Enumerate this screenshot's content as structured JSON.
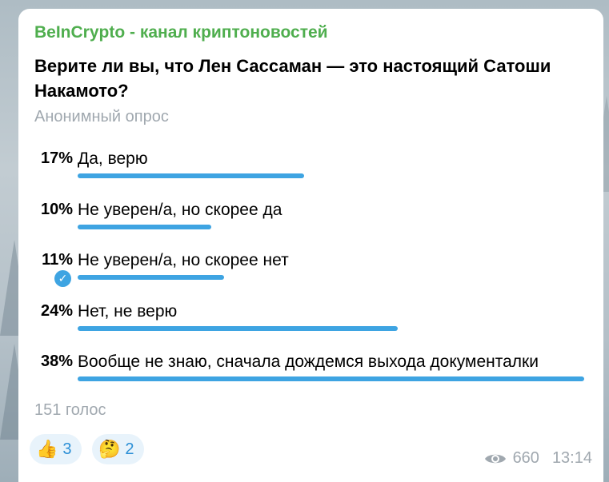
{
  "channel": {
    "name": "BeInCrypto - канал криптоновостей"
  },
  "poll": {
    "question": "Верите ли вы, что Лен Сассаман — это настоящий Сатоши Накамото?",
    "type_label": "Анонимный опрос",
    "options": [
      {
        "percent_label": "17%",
        "percent": 17,
        "text": "Да, верю",
        "selected": false
      },
      {
        "percent_label": "10%",
        "percent": 10,
        "text": "Не уверен/а, но скорее да",
        "selected": false
      },
      {
        "percent_label": "11%",
        "percent": 11,
        "text": "Не уверен/а, но скорее нет",
        "selected": true
      },
      {
        "percent_label": "24%",
        "percent": 24,
        "text": "Нет, не верю",
        "selected": false
      },
      {
        "percent_label": "38%",
        "percent": 38,
        "text": "Вообще не знаю, сначала дождемся выхода документалки",
        "selected": false
      }
    ],
    "votes_label": "151 голос"
  },
  "reactions": [
    {
      "emoji": "👍",
      "icon": "thumbs-up-icon",
      "count": "3"
    },
    {
      "emoji": "🤔",
      "icon": "thinking-face-icon",
      "count": "2"
    }
  ],
  "meta": {
    "views": "660",
    "time": "13:14"
  },
  "colors": {
    "accent": "#3ea4e2",
    "channel_name": "#4fae4e",
    "muted": "#a0a8af",
    "reaction_bg": "#e8f3fb"
  }
}
